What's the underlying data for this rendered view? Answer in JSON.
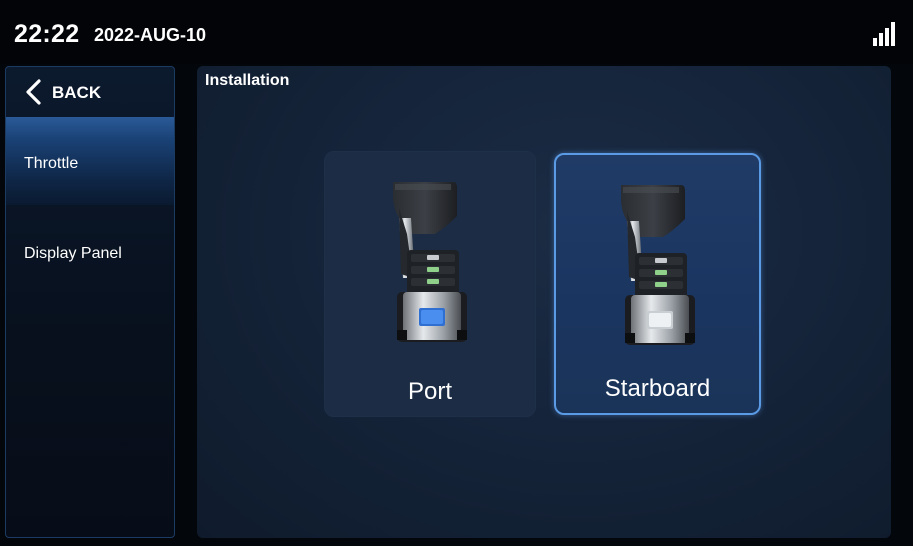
{
  "status_bar": {
    "time": "22:22",
    "date": "2022-AUG-10",
    "signal_icon": "signal-strength-icon"
  },
  "sidebar": {
    "back_label": "BACK",
    "back_icon": "chevron-left-icon",
    "items": [
      {
        "label": "Throttle",
        "active": true
      },
      {
        "label": "Display Panel",
        "active": false
      }
    ]
  },
  "main": {
    "title": "Installation",
    "options": [
      {
        "label": "Port",
        "selected": false,
        "button_color": "#2f6fd1"
      },
      {
        "label": "Starboard",
        "selected": true,
        "button_color": "#e4e8ec"
      }
    ]
  },
  "colors": {
    "accent_border": "#5b9ae4",
    "active_nav": "#1a4276",
    "panel_bg": "#15243a",
    "background": "#03060a"
  }
}
